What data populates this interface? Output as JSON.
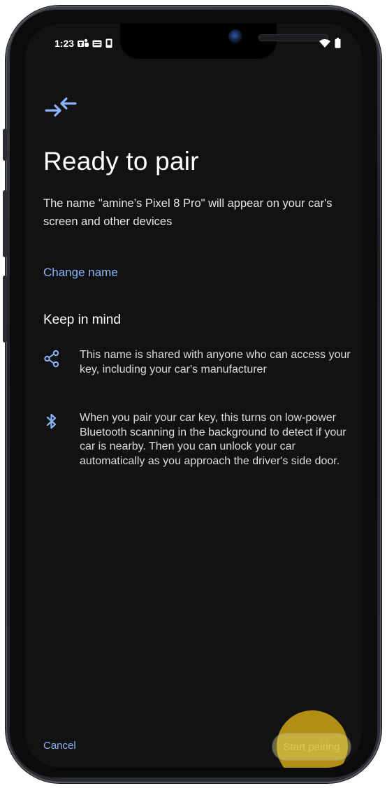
{
  "status_bar": {
    "time": "1:23",
    "left_icons": [
      "teams-icon",
      "message-icon",
      "phone-status-icon"
    ],
    "right_icons": [
      "wifi-icon",
      "battery-icon"
    ]
  },
  "header": {
    "icon": "pair-arrows-icon",
    "title": "Ready to pair",
    "description": "The name \"amine’s Pixel 8 Pro\" will appear on your car's screen and other devices"
  },
  "actions": {
    "change_name": "Change name"
  },
  "keep_in_mind": {
    "heading": "Keep in mind",
    "items": [
      {
        "icon": "share-icon",
        "text": "This name is shared with anyone who can access your key, including your car's manufacturer"
      },
      {
        "icon": "bluetooth-icon",
        "text": "When you pair your car key, this turns on low-power Bluetooth scanning in the background to detect if your car is nearby. Then you can unlock your car automatically as you approach the driver's side door."
      }
    ]
  },
  "footer": {
    "cancel_label": "Cancel",
    "start_label": "Start pairing"
  },
  "colors": {
    "background": "#121212",
    "accent": "#8ab4f8",
    "highlight": "#c7a012"
  }
}
